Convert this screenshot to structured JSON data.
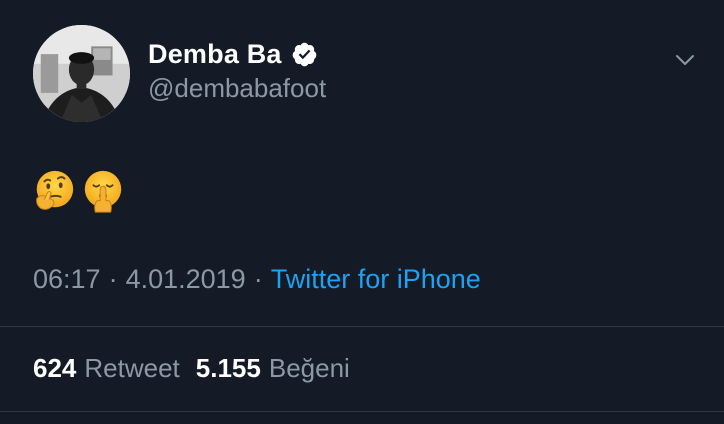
{
  "user": {
    "display_name": "Demba Ba",
    "handle": "@dembabafoot"
  },
  "tweet": {
    "emojis": [
      {
        "name": "thinking-face"
      },
      {
        "name": "shushing-face"
      }
    ],
    "time": "06:17",
    "separator": "·",
    "date": "4.01.2019",
    "source": "Twitter for iPhone"
  },
  "stats": {
    "retweets_count": "624",
    "retweets_label": "Retweet",
    "likes_count": "5.155",
    "likes_label": "Beğeni"
  },
  "colors": {
    "background": "#151b26",
    "secondary_text": "#8b98a5",
    "accent": "#1da1f2",
    "divider": "#2f3843"
  },
  "icons": [
    "verified-badge-icon",
    "chevron-down-icon"
  ]
}
